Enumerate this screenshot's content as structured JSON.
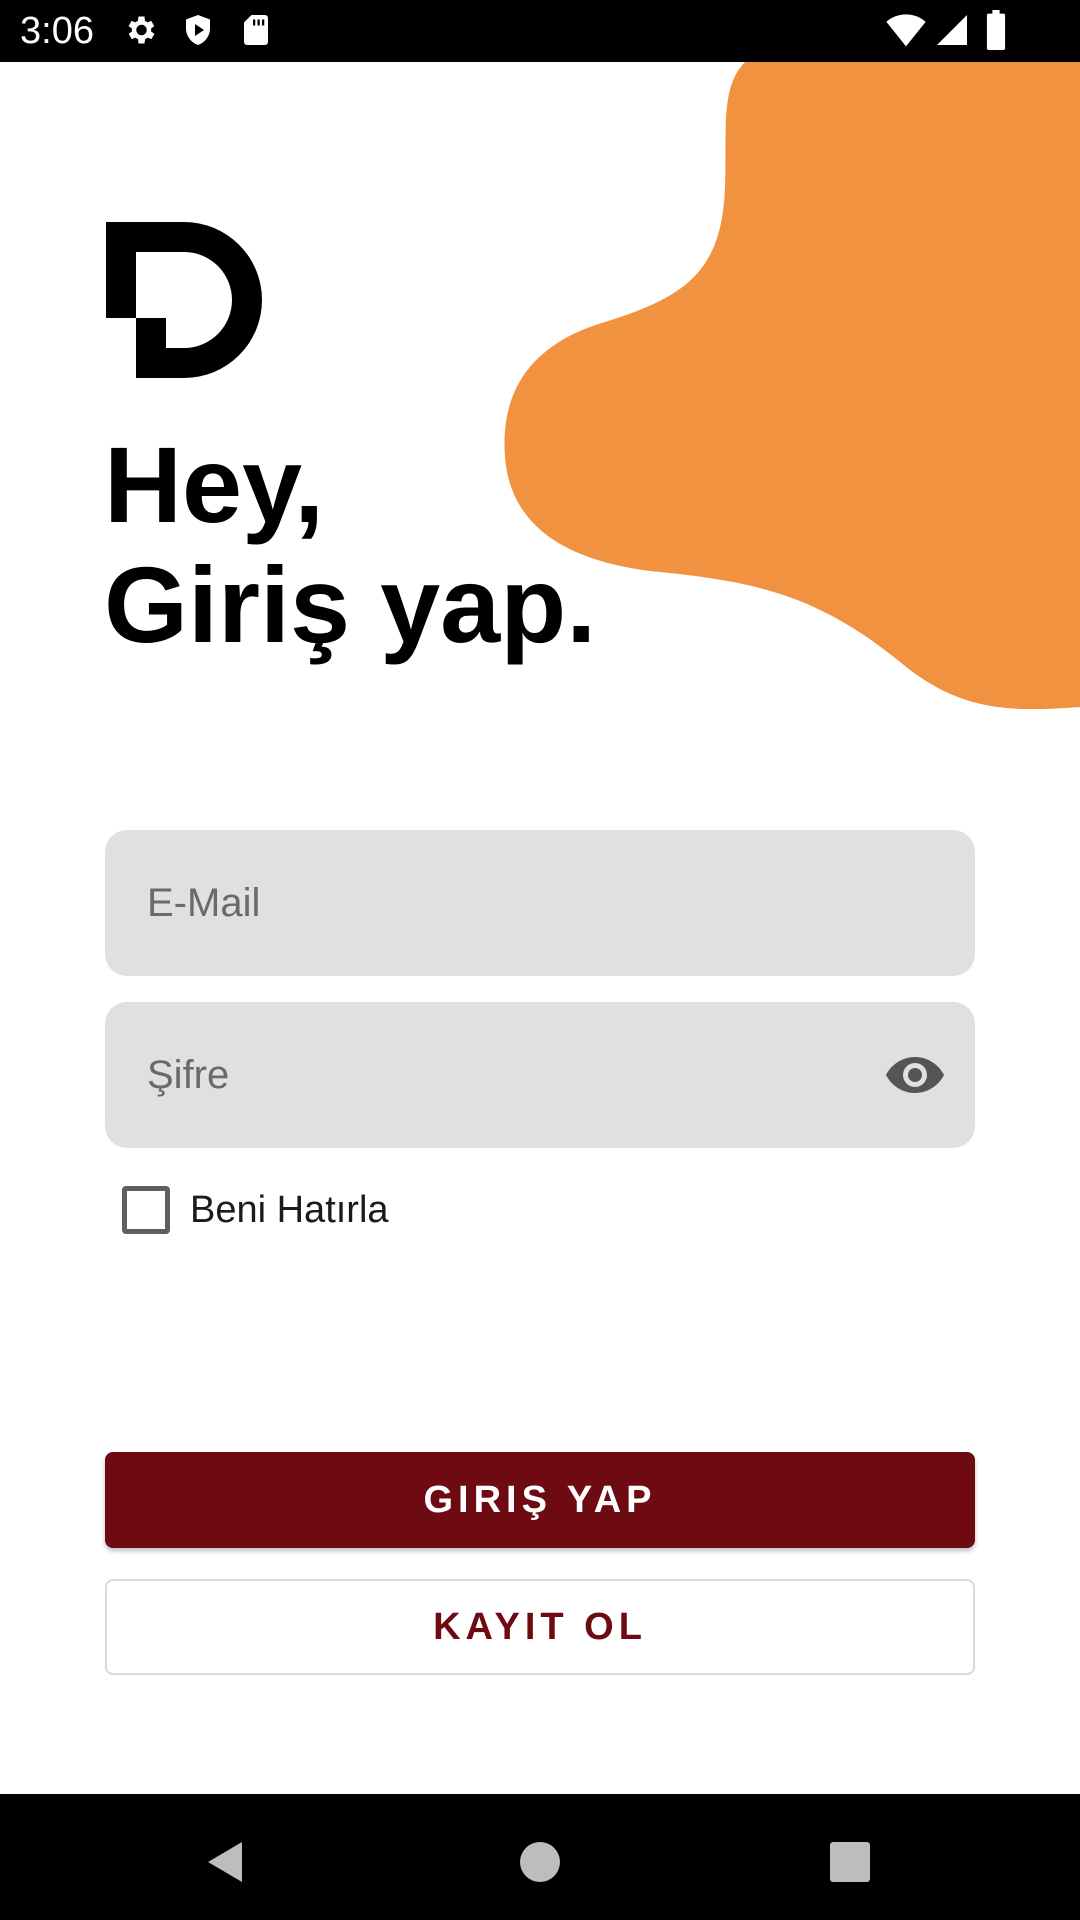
{
  "status_bar": {
    "time": "3:06",
    "left_icons": [
      "gear-icon",
      "shield-play-icon",
      "sd-card-icon"
    ],
    "right_icons": [
      "wifi-icon",
      "cell-signal-icon",
      "battery-icon"
    ]
  },
  "colors": {
    "accent_orange": "#f0923f",
    "primary_maroon": "#6e0a12",
    "field_background": "#e0e0e0"
  },
  "logo": {
    "icon": "d-logo-icon"
  },
  "heading": {
    "line1": "Hey,",
    "line2": "Giriş yap."
  },
  "form": {
    "email": {
      "placeholder": "E-Mail",
      "value": ""
    },
    "password": {
      "placeholder": "Şifre",
      "value": "",
      "toggle_icon": "eye-icon"
    },
    "remember": {
      "label": "Beni Hatırla",
      "checked": false
    }
  },
  "buttons": {
    "login": "GIRIŞ YAP",
    "register": "KAYIT OL"
  },
  "nav_bar": {
    "icons": [
      "back-triangle-icon",
      "home-circle-icon",
      "recents-square-icon"
    ]
  }
}
